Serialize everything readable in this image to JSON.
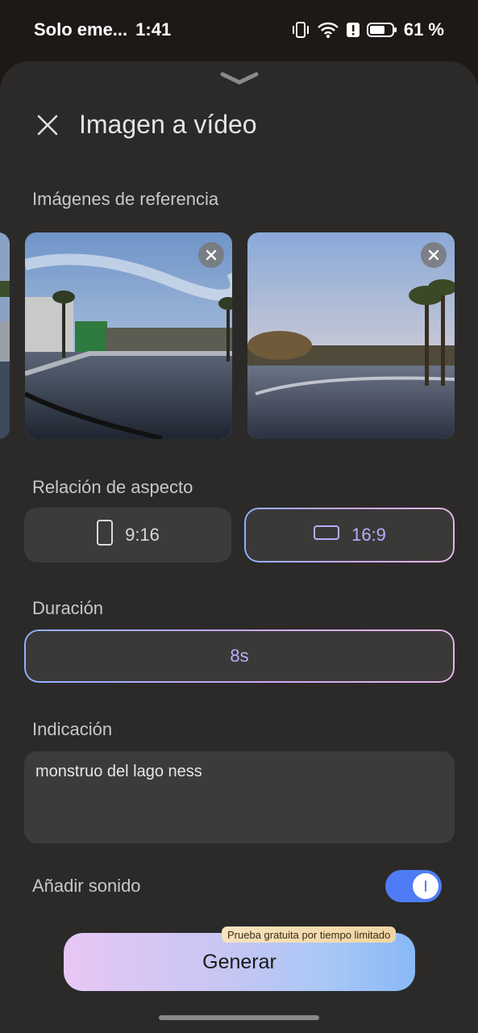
{
  "status_bar": {
    "carrier": "Solo eme...",
    "time": "1:41",
    "battery_percent": "61 %",
    "battery_level": 0.61
  },
  "header": {
    "title": "Imagen a vídeo"
  },
  "sections": {
    "reference_images_label": "Imágenes de referencia",
    "aspect_ratio_label": "Relación de aspecto",
    "duration_label": "Duración",
    "prompt_label": "Indicación",
    "sound_label": "Añadir sonido"
  },
  "aspect_ratio": {
    "options": [
      "9:16",
      "16:9"
    ],
    "selected": "16:9"
  },
  "duration": {
    "value": "8s"
  },
  "prompt": {
    "text": "monstruo del lago ness"
  },
  "sound": {
    "enabled": true
  },
  "generate": {
    "label": "Generar",
    "badge": "Prueba gratuita por tiempo limitado"
  },
  "colors": {
    "accent": "#b7aefc",
    "toggle_on": "#4f7cf5",
    "sheet_bg": "#2b2a29",
    "control_bg": "#3c3b3a"
  }
}
